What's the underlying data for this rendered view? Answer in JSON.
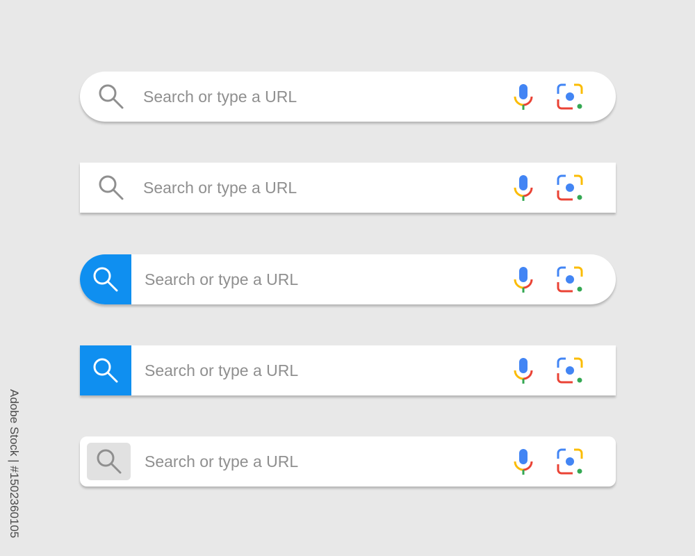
{
  "search_bars": [
    {
      "style": "pill",
      "search_button_style": "plain",
      "placeholder": "Search or type a URL"
    },
    {
      "style": "rectangle",
      "search_button_style": "plain",
      "placeholder": "Search or type a URL"
    },
    {
      "style": "pill",
      "search_button_style": "filled-blue",
      "placeholder": "Search or type a URL"
    },
    {
      "style": "rectangle",
      "search_button_style": "filled-blue",
      "placeholder": "Search or type a URL"
    },
    {
      "style": "rounded-rectangle",
      "search_button_style": "boxed-gray",
      "placeholder": "Search or type a URL"
    }
  ],
  "icons": {
    "search": "magnifier-icon",
    "voice": "microphone-icon",
    "lens": "camera-lens-icon"
  },
  "colors": {
    "background": "#e8e8e8",
    "bar_background": "#ffffff",
    "accent_blue": "#0f8ff0",
    "search_icon_gray": "#8f8f8f",
    "placeholder_gray": "#8f8f8f",
    "boxed_button_gray": "#e1e1e1",
    "google_blue": "#4285f4",
    "google_red": "#ea4335",
    "google_yellow": "#fbbc05",
    "google_green": "#34a853"
  },
  "credit": "Adobe Stock | #1502360105"
}
